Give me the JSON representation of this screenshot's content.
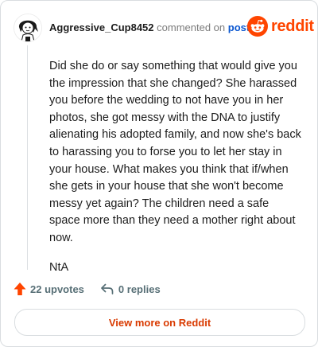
{
  "comment": {
    "username": "Aggressive_Cup8452",
    "action_text": "commented on",
    "post_link": "post",
    "paragraphs": [
      "Did she do or say something that would give you the impression that she changed? She harassed you before the wedding to not have you in her photos, she got messy with the DNA to justify alienating his adopted family, and now she's back to harassing you to forse you to let her stay in your house. What makes you think that if/when she gets in your house that she won't become messy yet again? The children need a safe space more than they need a mother right about now.",
      "NtA"
    ]
  },
  "brand": {
    "name": "reddit",
    "icon": "reddit-snoo-icon",
    "color": "#ff4500"
  },
  "stats": {
    "upvotes_label": "22 upvotes",
    "replies_label": "0 replies",
    "upvote_icon": "upvote-arrow-icon",
    "reply_icon": "reply-arrow-icon",
    "upvote_color": "#ff4500"
  },
  "footer": {
    "view_more_label": "View more on Reddit"
  }
}
